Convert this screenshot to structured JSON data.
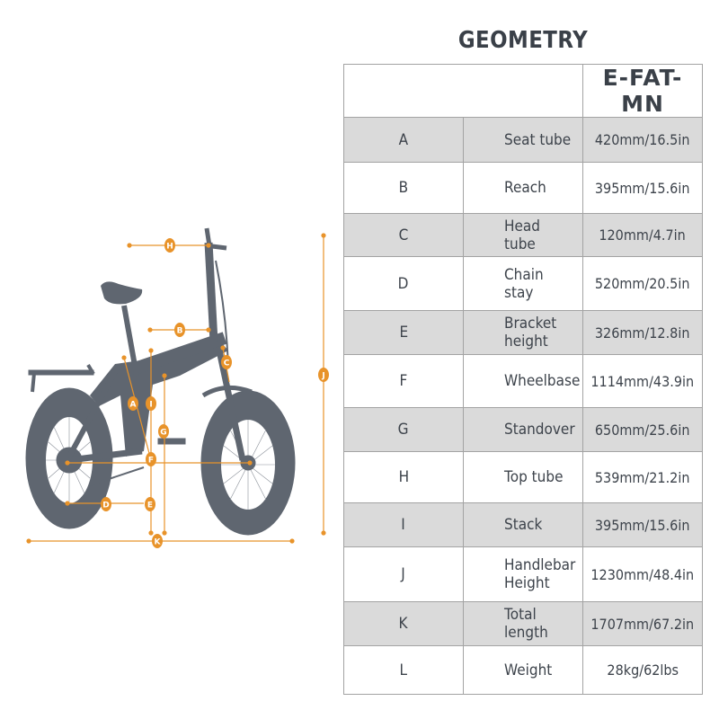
{
  "header": {
    "title": "GEOMETRY",
    "model": "E-FAT-MN"
  },
  "colors": {
    "accent": "#E8932A",
    "silhouette": "#5F6670",
    "row_shade": "#DADADA",
    "text": "#3A4048"
  },
  "rows": [
    {
      "letter": "A",
      "label": "Seat tube",
      "value": "420mm/16.5in"
    },
    {
      "letter": "B",
      "label": "Reach",
      "value": "395mm/15.6in"
    },
    {
      "letter": "C",
      "label": "Head tube",
      "value": "120mm/4.7in"
    },
    {
      "letter": "D",
      "label": "Chain stay",
      "value": "520mm/20.5in"
    },
    {
      "letter": "E",
      "label": "Bracket height",
      "value": "326mm/12.8in"
    },
    {
      "letter": "F",
      "label": "Wheelbase",
      "value": "1114mm/43.9in"
    },
    {
      "letter": "G",
      "label": "Standover",
      "value": "650mm/25.6in"
    },
    {
      "letter": "H",
      "label": "Top tube",
      "value": "539mm/21.2in"
    },
    {
      "letter": "I",
      "label": "Stack",
      "value": "395mm/15.6in"
    },
    {
      "letter": "J",
      "label": "Handlebar Height",
      "value": "1230mm/48.4in"
    },
    {
      "letter": "K",
      "label": "Total length",
      "value": "1707mm/67.2in"
    },
    {
      "letter": "L",
      "label": "Weight",
      "value": "28kg/62lbs"
    }
  ],
  "diagram": {
    "markers": [
      "A",
      "B",
      "C",
      "D",
      "E",
      "F",
      "G",
      "H",
      "I",
      "J",
      "K"
    ]
  }
}
